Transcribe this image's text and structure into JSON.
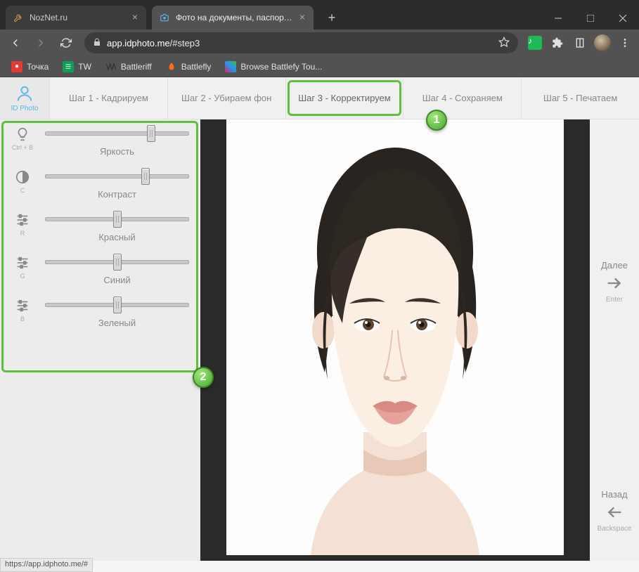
{
  "browser": {
    "tabs": [
      {
        "title": "NozNet.ru"
      },
      {
        "title": "Фото на документы, паспорта, в"
      }
    ],
    "url_host": "app.idphoto.me",
    "url_path": "/#step3"
  },
  "bookmarks": [
    {
      "label": "Точка"
    },
    {
      "label": "TW"
    },
    {
      "label": "Battleriff"
    },
    {
      "label": "Battlefly"
    },
    {
      "label": "Browse Battlefy Tou..."
    }
  ],
  "app": {
    "logo_text": "ID Photo",
    "steps": [
      "Шаг 1 - Кадрируем",
      "Шаг 2 - Убираем фон",
      "Шаг 3 - Корректируем",
      "Шаг 4 - Сохраняем",
      "Шаг 5 - Печатаем"
    ],
    "active_step_index": 2,
    "sliders": [
      {
        "shortcut": "Ctrl + B",
        "label": "Яркость",
        "value": 74
      },
      {
        "shortcut": "С",
        "label": "Контраст",
        "value": 70
      },
      {
        "shortcut": "R",
        "label": "Красный",
        "value": 50
      },
      {
        "shortcut": "G",
        "label": "Синий",
        "value": 50
      },
      {
        "shortcut": "B",
        "label": "Зеленый",
        "value": 50
      }
    ],
    "nav_next": {
      "label": "Далее",
      "key": "Enter"
    },
    "nav_back": {
      "label": "Назад",
      "key": "Backspace"
    },
    "status_url": "https://app.idphoto.me/#"
  },
  "callouts": {
    "one": "1",
    "two": "2"
  }
}
